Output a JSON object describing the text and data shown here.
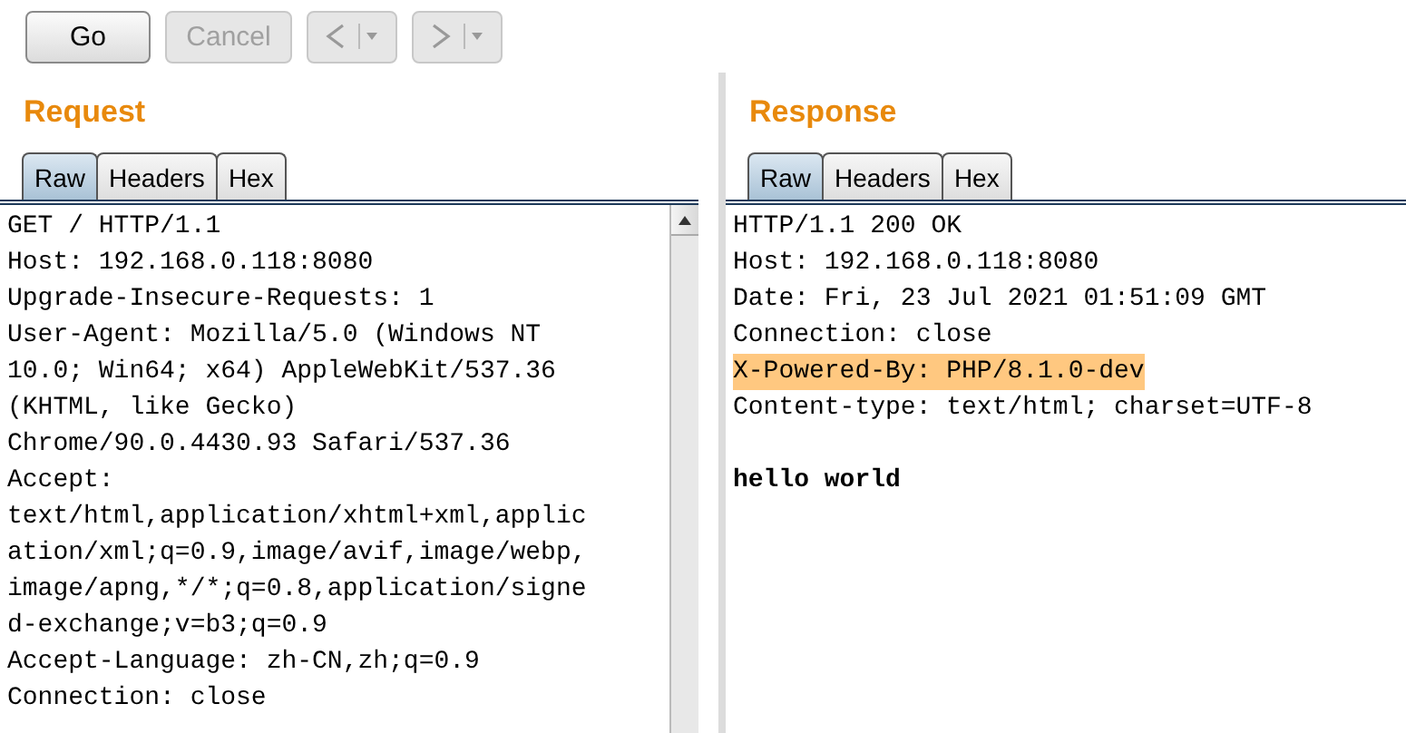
{
  "toolbar": {
    "buttons": [
      {
        "kind": "text",
        "label": "Go",
        "disabled": false
      },
      {
        "kind": "text",
        "label": "Cancel",
        "disabled": true
      },
      {
        "kind": "back",
        "disabled": true
      },
      {
        "kind": "forward",
        "disabled": true
      }
    ]
  },
  "request": {
    "title": "Request",
    "tabs": [
      {
        "label": "Raw",
        "selected": true
      },
      {
        "label": "Headers",
        "selected": false
      },
      {
        "label": "Hex",
        "selected": false
      }
    ],
    "lines": [
      {
        "text": "GET / HTTP/1.1"
      },
      {
        "text": "Host: 192.168.0.118:8080"
      },
      {
        "text": "Upgrade-Insecure-Requests: 1"
      },
      {
        "text": "User-Agent: Mozilla/5.0 (Windows NT"
      },
      {
        "text": "10.0; Win64; x64) AppleWebKit/537.36"
      },
      {
        "text": "(KHTML, like Gecko)"
      },
      {
        "text": "Chrome/90.0.4430.93 Safari/537.36"
      },
      {
        "text": "Accept:"
      },
      {
        "text": "text/html,application/xhtml+xml,applic"
      },
      {
        "text": "ation/xml;q=0.9,image/avif,image/webp,"
      },
      {
        "text": "image/apng,*/*;q=0.8,application/signe"
      },
      {
        "text": "d-exchange;v=b3;q=0.9"
      },
      {
        "text": "Accept-Language: zh-CN,zh;q=0.9"
      },
      {
        "text": "Connection: close"
      }
    ]
  },
  "response": {
    "title": "Response",
    "tabs": [
      {
        "label": "Raw",
        "selected": true
      },
      {
        "label": "Headers",
        "selected": false
      },
      {
        "label": "Hex",
        "selected": false
      }
    ],
    "lines": [
      {
        "text": "HTTP/1.1 200 OK",
        "highlighted": false
      },
      {
        "text": "Host: 192.168.0.118:8080",
        "highlighted": false
      },
      {
        "text": "Date: Fri, 23 Jul 2021 01:51:09 GMT",
        "highlighted": false
      },
      {
        "text": "Connection: close",
        "highlighted": false
      },
      {
        "text": "X-Powered-By: PHP/8.1.0-dev",
        "highlighted": true
      },
      {
        "text": "Content-type: text/html; charset=UTF-8",
        "highlighted": false
      }
    ],
    "body": "hello world"
  }
}
